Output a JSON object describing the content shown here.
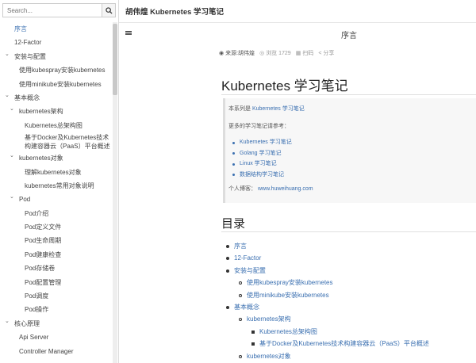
{
  "search": {
    "placeholder": "Search..."
  },
  "sidebar": {
    "items": [
      {
        "label": "序言",
        "level": 0,
        "caret": false,
        "active": true
      },
      {
        "label": "12-Factor",
        "level": 0,
        "caret": false
      },
      {
        "label": "安装与配置",
        "level": 0,
        "caret": true
      },
      {
        "label": "使用kubespray安装kubernetes",
        "level": 1,
        "caret": false
      },
      {
        "label": "使用minikube安装kubernetes",
        "level": 1,
        "caret": false
      },
      {
        "label": "基本概念",
        "level": 0,
        "caret": true
      },
      {
        "label": "kubernetes架构",
        "level": 1,
        "caret": true
      },
      {
        "label": "Kubernetes总架构图",
        "level": 2,
        "caret": false
      },
      {
        "label": "基于Docker及Kubernetes技术构建容器云（PaaS）平台概述",
        "level": 2,
        "caret": false,
        "multi": true
      },
      {
        "label": "kubernetes对象",
        "level": 1,
        "caret": true
      },
      {
        "label": "理解kubernetes对象",
        "level": 2,
        "caret": false
      },
      {
        "label": "kubernetes常用对象说明",
        "level": 2,
        "caret": false
      },
      {
        "label": "Pod",
        "level": 1,
        "caret": true
      },
      {
        "label": "Pod介绍",
        "level": 2,
        "caret": false
      },
      {
        "label": "Pod定义文件",
        "level": 2,
        "caret": false
      },
      {
        "label": "Pod生命周期",
        "level": 2,
        "caret": false
      },
      {
        "label": "Pod健康检查",
        "level": 2,
        "caret": false
      },
      {
        "label": "Pod存储卷",
        "level": 2,
        "caret": false
      },
      {
        "label": "Pod配置管理",
        "level": 2,
        "caret": false
      },
      {
        "label": "Pod调度",
        "level": 2,
        "caret": false
      },
      {
        "label": "Pod操作",
        "level": 2,
        "caret": false
      },
      {
        "label": "核心原理",
        "level": 0,
        "caret": true
      },
      {
        "label": "Api Server",
        "level": 1,
        "caret": false
      },
      {
        "label": "Controller Manager",
        "level": 1,
        "caret": false
      }
    ]
  },
  "header": {
    "book_title": "胡伟煌 Kubernetes 学习笔记",
    "chapter_title": "序言"
  },
  "meta": {
    "source": "来源:胡伟煌",
    "views": "浏览 1729",
    "print": "扫码",
    "share": "分享"
  },
  "content": {
    "h1": "Kubernetes 学习笔记",
    "quote": {
      "line1_prefix": "本系列是",
      "line1_link": "Kubernetes 学习笔记",
      "line2": "更多的学习笔记请参考：",
      "links": [
        "Kubernetes 学习笔记",
        "Golang 学习笔记",
        "Linux 学习笔记",
        "数据结构学习笔记"
      ],
      "blog_prefix": "个人博客：",
      "blog_link": "www.huweihuang.com"
    },
    "h2": "目录",
    "toc": [
      {
        "label": "序言",
        "level": 0
      },
      {
        "label": "12-Factor",
        "level": 0
      },
      {
        "label": "安装与配置",
        "level": 0
      },
      {
        "label": "使用kubespray安装kubernetes",
        "level": 1
      },
      {
        "label": "使用minikube安装kubernetes",
        "level": 1
      },
      {
        "label": "基本概念",
        "level": 0
      },
      {
        "label": "kubernetes架构",
        "level": 1
      },
      {
        "label": "Kubernetes总架构图",
        "level": 2
      },
      {
        "label": "基于Docker及Kubernetes技术构建容器云（PaaS）平台概述",
        "level": 2
      },
      {
        "label": "kubernetes对象",
        "level": 1
      }
    ]
  },
  "colors": {
    "link": "#3a6fb0",
    "text": "#333333",
    "border": "#dddddd"
  },
  "icons": {
    "search": "search-icon",
    "menu": "menu-icon",
    "source": "globe-icon",
    "views": "eye-icon",
    "print": "qrcode-icon",
    "share": "share-icon"
  }
}
